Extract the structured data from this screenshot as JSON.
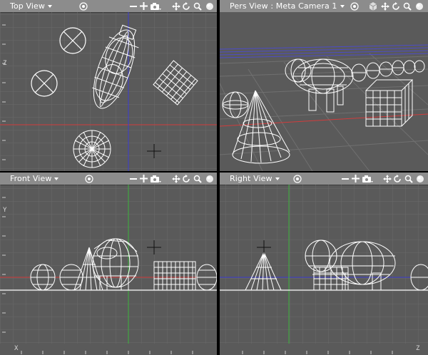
{
  "viewports": {
    "top": {
      "title": "Top View"
    },
    "pers": {
      "title": "Pers View : Meta Camera 1"
    },
    "front": {
      "title": "Front View"
    },
    "right": {
      "title": "Right View"
    }
  },
  "axes": {
    "z_top": "Z",
    "y_front": "Y",
    "x_bottom": "X",
    "z_bottom": "Z"
  },
  "icons": {
    "target": "target-icon",
    "zoom_out": "minus-icon",
    "pan": "plus-move-icon",
    "camera": "camera-icon",
    "move": "move-arrows-icon",
    "rotate": "rotate-icon",
    "zoom": "magnifier-icon",
    "sphere": "sphere-icon",
    "cube": "cube-icon"
  },
  "colors": {
    "viewport_bg": "#5a5a5a",
    "titlebar": "#8c8c8c",
    "grid": "#6a6a6a",
    "axis_x": "#d23c3c",
    "axis_z": "#3c3cd2",
    "axis_y": "#3cb43c",
    "wire": "#ffffff"
  }
}
